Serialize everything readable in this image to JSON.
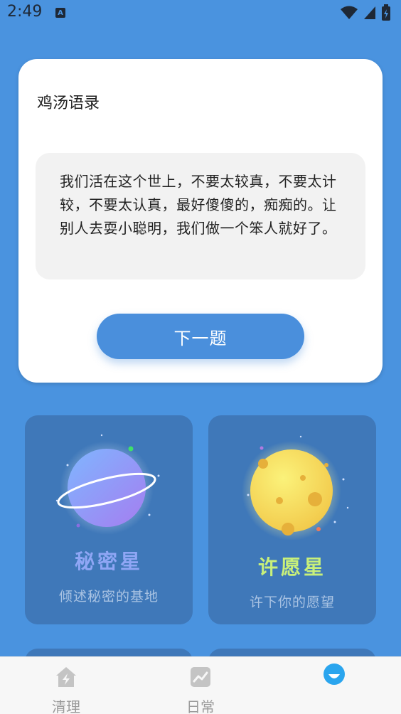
{
  "status_bar": {
    "time": "2:49",
    "notification_icon": "A"
  },
  "quote_card": {
    "title": "鸡汤语录",
    "quote": "我们活在这个世上，不要太较真，不要太计较，不要太认真，最好傻傻的，痴痴的。让别人去耍小聪明，我们做一个笨人就好了。",
    "next_button_label": "下一题"
  },
  "planets": [
    {
      "name": "秘密星",
      "subtitle": "倾述秘密的基地",
      "name_color": "#8fa6f5",
      "icon": "ringed-planet-icon"
    },
    {
      "name": "许愿星",
      "subtitle": "许下你的愿望",
      "name_color": "#c8f07a",
      "icon": "moon-planet-icon"
    }
  ],
  "bottom_nav": {
    "items": [
      {
        "label": "清理",
        "icon": "bolt-house-icon"
      },
      {
        "label": "日常",
        "icon": "trend-chart-icon"
      },
      {
        "label": "",
        "icon": "smile-face-icon"
      }
    ]
  },
  "colors": {
    "background": "#4a93df",
    "card": "#ffffff",
    "button": "#4a8fdc",
    "planet_card": "#3f78b9",
    "active_nav": "#2aa5ee"
  }
}
